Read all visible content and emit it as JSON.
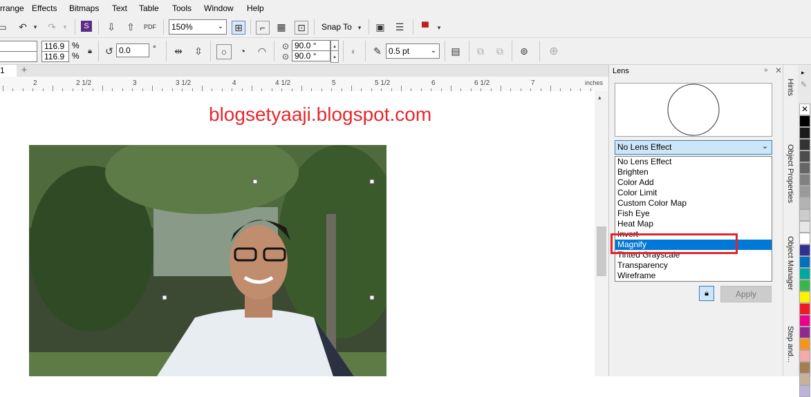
{
  "menu": [
    "rrange",
    "Effects",
    "Bitmaps",
    "Text",
    "Table",
    "Tools",
    "Window",
    "Help"
  ],
  "toolbar": {
    "zoom_value": "150%",
    "snap_label": "Snap To"
  },
  "propbar": {
    "scale_x": "116.9",
    "scale_y": "116.9",
    "percent": "%",
    "rotation": "0.0",
    "degree": "°",
    "angle_top": "90.0 °",
    "angle_bottom": "90.0 °",
    "outline_width": "0.5 pt"
  },
  "doc_tab": {
    "label": "1",
    "add": "+"
  },
  "ruler": {
    "labels": [
      "2",
      "2 1/2",
      "3",
      "3 1/2",
      "4",
      "4 1/2",
      "5",
      "5 1/2",
      "6",
      "6 1/2",
      "7"
    ],
    "unit": "inches"
  },
  "canvas": {
    "watermark": "blogsetyaaji.blogspot.com"
  },
  "docker": {
    "title": "Lens",
    "selected": "No Lens Effect",
    "options": [
      "No Lens Effect",
      "Brighten",
      "Color Add",
      "Color Limit",
      "Custom Color Map",
      "Fish Eye",
      "Heat Map",
      "Invert",
      "Magnify",
      "Tinted Grayscale",
      "Transparency",
      "Wireframe"
    ],
    "highlighted": "Magnify",
    "apply_label": "Apply"
  },
  "side_tabs": [
    "Hints",
    "Object Properties",
    "Object Manager",
    "Step and..."
  ],
  "palette": [
    "#ffffff",
    "#000000",
    "#1a1a1a",
    "#333333",
    "#4d4d4d",
    "#666666",
    "#808080",
    "#999999",
    "#b3b3b3",
    "#cccccc",
    "#e6e6e6",
    "#ffffff",
    "#2e3192",
    "#0071bc",
    "#00a99d",
    "#39b54a",
    "#fff200",
    "#ed1c24",
    "#ec008c",
    "#92278f",
    "#f7941d",
    "#f5a9a9",
    "#a67c52",
    "#c7b299",
    "#bdb3d9"
  ],
  "colors": {
    "watermark": "#e8262b",
    "highlight_box": "#e2232a",
    "selection": "#0078d7"
  }
}
